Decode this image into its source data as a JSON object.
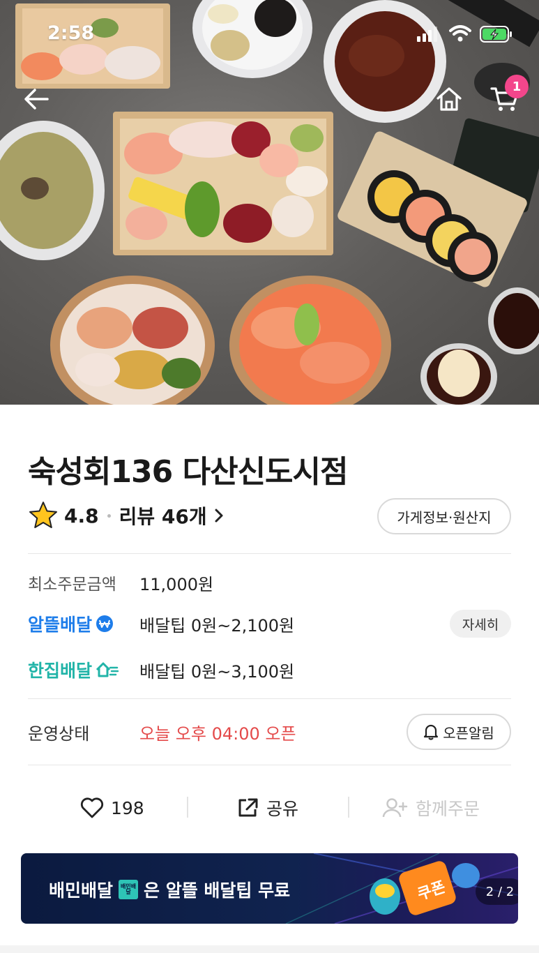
{
  "status_bar": {
    "time": "2:58"
  },
  "header": {
    "cart_count": "1"
  },
  "store": {
    "name": "숙성회136 다산신도시점",
    "rating": "4.8",
    "review_label": "리뷰 46개",
    "info_button": "가게정보·원산지"
  },
  "order": {
    "min_order_label": "최소주문금액",
    "min_order_value": "11,000원",
    "al_brand": "알뜰배달",
    "al_tip": "배달팁 0원~2,100원",
    "detail_button": "자세히",
    "han_brand": "한집배달",
    "han_tip": "배달팁 0원~3,100원"
  },
  "operation": {
    "label": "운영상태",
    "value": "오늘 오후 04:00 오픈",
    "alarm_button": "오픈알림"
  },
  "actions": {
    "like_count": "198",
    "share_label": "공유",
    "group_order_label": "함께주문"
  },
  "banner": {
    "text_prefix": "배민배달",
    "chip_text": "배민배달",
    "text_suffix": "은 알뜰 배달팁 무료",
    "coupon": "쿠폰",
    "page": "2 / 2"
  },
  "colors": {
    "accent_blue": "#1e7dea",
    "accent_teal": "#21b4a8",
    "open_red": "#e44a4a",
    "cart_badge": "#f3468b"
  }
}
